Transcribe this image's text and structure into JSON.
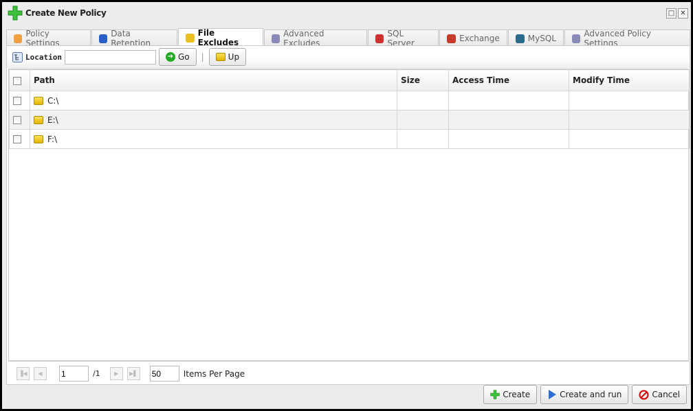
{
  "window": {
    "title": "Create New Policy",
    "icon": "plus-icon"
  },
  "tabs": [
    {
      "label": "Policy Settings",
      "icon": "clipboard-icon",
      "active": false
    },
    {
      "label": "Data Retention",
      "icon": "cubes-icon",
      "active": false
    },
    {
      "label": "File Excludes",
      "icon": "folder-icon",
      "active": true
    },
    {
      "label": "Advanced Excludes",
      "icon": "gears-icon",
      "active": false
    },
    {
      "label": "SQL Server",
      "icon": "sql-server-icon",
      "active": false
    },
    {
      "label": "Exchange",
      "icon": "exchange-icon",
      "active": false
    },
    {
      "label": "MySQL",
      "icon": "mysql-icon",
      "active": false
    },
    {
      "label": "Advanced Policy Settings",
      "icon": "gears-icon",
      "active": false
    }
  ],
  "toolbar": {
    "location_label": "Location",
    "location_value": "",
    "go_label": "Go",
    "up_label": "Up"
  },
  "grid": {
    "columns": [
      "Path",
      "Size",
      "Access Time",
      "Modify Time"
    ],
    "rows": [
      {
        "path": "C:\\",
        "size": "",
        "access": "",
        "modify": ""
      },
      {
        "path": "E:\\",
        "size": "",
        "access": "",
        "modify": ""
      },
      {
        "path": "F:\\",
        "size": "",
        "access": "",
        "modify": ""
      }
    ]
  },
  "pager": {
    "page": "1",
    "total": "/1",
    "per_page": "50",
    "per_page_label": "Items Per Page"
  },
  "buttons": {
    "create": "Create",
    "create_run": "Create and run",
    "cancel": "Cancel"
  }
}
